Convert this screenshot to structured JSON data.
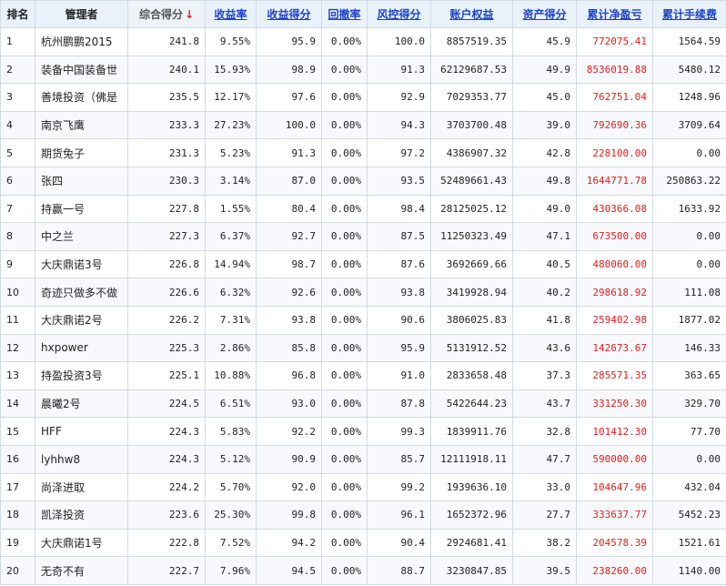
{
  "headers": {
    "rank": "排名",
    "manager": "管理者",
    "composite": "综合得分",
    "sort_arrow": "↓",
    "return_rate": "收益率",
    "return_score": "收益得分",
    "drawdown": "回撤率",
    "risk_score": "风控得分",
    "equity": "账户权益",
    "asset_score": "资产得分",
    "net_pnl": "累计净盈亏",
    "fees": "累计手续费"
  },
  "rows": [
    {
      "rank": "1",
      "manager": "杭州鹏鹏2015",
      "composite": "241.8",
      "return_rate": "9.55%",
      "return_score": "95.9",
      "drawdown": "0.00%",
      "risk_score": "100.0",
      "equity": "8857519.35",
      "asset_score": "45.9",
      "net_pnl": "772075.41",
      "fees": "1564.59"
    },
    {
      "rank": "2",
      "manager": "装备中国装备世",
      "composite": "240.1",
      "return_rate": "15.93%",
      "return_score": "98.9",
      "drawdown": "0.00%",
      "risk_score": "91.3",
      "equity": "62129687.53",
      "asset_score": "49.9",
      "net_pnl": "8536019.88",
      "fees": "5480.12"
    },
    {
      "rank": "3",
      "manager": "善境投资（佛是",
      "composite": "235.5",
      "return_rate": "12.17%",
      "return_score": "97.6",
      "drawdown": "0.00%",
      "risk_score": "92.9",
      "equity": "7029353.77",
      "asset_score": "45.0",
      "net_pnl": "762751.04",
      "fees": "1248.96"
    },
    {
      "rank": "4",
      "manager": "南京飞鹰",
      "composite": "233.3",
      "return_rate": "27.23%",
      "return_score": "100.0",
      "drawdown": "0.00%",
      "risk_score": "94.3",
      "equity": "3703700.48",
      "asset_score": "39.0",
      "net_pnl": "792690.36",
      "fees": "3709.64"
    },
    {
      "rank": "5",
      "manager": "期货兔子",
      "composite": "231.3",
      "return_rate": "5.23%",
      "return_score": "91.3",
      "drawdown": "0.00%",
      "risk_score": "97.2",
      "equity": "4386907.32",
      "asset_score": "42.8",
      "net_pnl": "228100.00",
      "fees": "0.00"
    },
    {
      "rank": "6",
      "manager": "张四",
      "composite": "230.3",
      "return_rate": "3.14%",
      "return_score": "87.0",
      "drawdown": "0.00%",
      "risk_score": "93.5",
      "equity": "52489661.43",
      "asset_score": "49.8",
      "net_pnl": "1644771.78",
      "fees": "250863.22"
    },
    {
      "rank": "7",
      "manager": "持赢一号",
      "composite": "227.8",
      "return_rate": "1.55%",
      "return_score": "80.4",
      "drawdown": "0.00%",
      "risk_score": "98.4",
      "equity": "28125025.12",
      "asset_score": "49.0",
      "net_pnl": "430366.08",
      "fees": "1633.92"
    },
    {
      "rank": "8",
      "manager": "中之兰",
      "composite": "227.3",
      "return_rate": "6.37%",
      "return_score": "92.7",
      "drawdown": "0.00%",
      "risk_score": "87.5",
      "equity": "11250323.49",
      "asset_score": "47.1",
      "net_pnl": "673500.00",
      "fees": "0.00"
    },
    {
      "rank": "9",
      "manager": "大庆鼎诺3号",
      "composite": "226.8",
      "return_rate": "14.94%",
      "return_score": "98.7",
      "drawdown": "0.00%",
      "risk_score": "87.6",
      "equity": "3692669.66",
      "asset_score": "40.5",
      "net_pnl": "480060.00",
      "fees": "0.00"
    },
    {
      "rank": "10",
      "manager": "奇迹只做多不做",
      "composite": "226.6",
      "return_rate": "6.32%",
      "return_score": "92.6",
      "drawdown": "0.00%",
      "risk_score": "93.8",
      "equity": "3419928.94",
      "asset_score": "40.2",
      "net_pnl": "298618.92",
      "fees": "111.08"
    },
    {
      "rank": "11",
      "manager": "大庆鼎诺2号",
      "composite": "226.2",
      "return_rate": "7.31%",
      "return_score": "93.8",
      "drawdown": "0.00%",
      "risk_score": "90.6",
      "equity": "3806025.83",
      "asset_score": "41.8",
      "net_pnl": "259402.98",
      "fees": "1877.02"
    },
    {
      "rank": "12",
      "manager": "hxpower",
      "composite": "225.3",
      "return_rate": "2.86%",
      "return_score": "85.8",
      "drawdown": "0.00%",
      "risk_score": "95.9",
      "equity": "5131912.52",
      "asset_score": "43.6",
      "net_pnl": "142673.67",
      "fees": "146.33"
    },
    {
      "rank": "13",
      "manager": "持盈投资3号",
      "composite": "225.1",
      "return_rate": "10.88%",
      "return_score": "96.8",
      "drawdown": "0.00%",
      "risk_score": "91.0",
      "equity": "2833658.48",
      "asset_score": "37.3",
      "net_pnl": "285571.35",
      "fees": "363.65"
    },
    {
      "rank": "14",
      "manager": "晨曦2号",
      "composite": "224.5",
      "return_rate": "6.51%",
      "return_score": "93.0",
      "drawdown": "0.00%",
      "risk_score": "87.8",
      "equity": "5422644.23",
      "asset_score": "43.7",
      "net_pnl": "331250.30",
      "fees": "329.70"
    },
    {
      "rank": "15",
      "manager": "HFF",
      "composite": "224.3",
      "return_rate": "5.83%",
      "return_score": "92.2",
      "drawdown": "0.00%",
      "risk_score": "99.3",
      "equity": "1839911.76",
      "asset_score": "32.8",
      "net_pnl": "101412.30",
      "fees": "77.70"
    },
    {
      "rank": "16",
      "manager": "lyhhw8",
      "composite": "224.3",
      "return_rate": "5.12%",
      "return_score": "90.9",
      "drawdown": "0.00%",
      "risk_score": "85.7",
      "equity": "12111918.11",
      "asset_score": "47.7",
      "net_pnl": "590000.00",
      "fees": "0.00"
    },
    {
      "rank": "17",
      "manager": "尚泽进取",
      "composite": "224.2",
      "return_rate": "5.70%",
      "return_score": "92.0",
      "drawdown": "0.00%",
      "risk_score": "99.2",
      "equity": "1939636.10",
      "asset_score": "33.0",
      "net_pnl": "104647.96",
      "fees": "432.04"
    },
    {
      "rank": "18",
      "manager": "凯泽投资",
      "composite": "223.6",
      "return_rate": "25.30%",
      "return_score": "99.8",
      "drawdown": "0.00%",
      "risk_score": "96.1",
      "equity": "1652372.96",
      "asset_score": "27.7",
      "net_pnl": "333637.77",
      "fees": "5452.23"
    },
    {
      "rank": "19",
      "manager": "大庆鼎诺1号",
      "composite": "222.8",
      "return_rate": "7.52%",
      "return_score": "94.2",
      "drawdown": "0.00%",
      "risk_score": "90.4",
      "equity": "2924681.41",
      "asset_score": "38.2",
      "net_pnl": "204578.39",
      "fees": "1521.61"
    },
    {
      "rank": "20",
      "manager": "无奇不有",
      "composite": "222.7",
      "return_rate": "7.96%",
      "return_score": "94.5",
      "drawdown": "0.00%",
      "risk_score": "88.7",
      "equity": "3230847.85",
      "asset_score": "39.5",
      "net_pnl": "238260.00",
      "fees": "1140.00"
    }
  ]
}
